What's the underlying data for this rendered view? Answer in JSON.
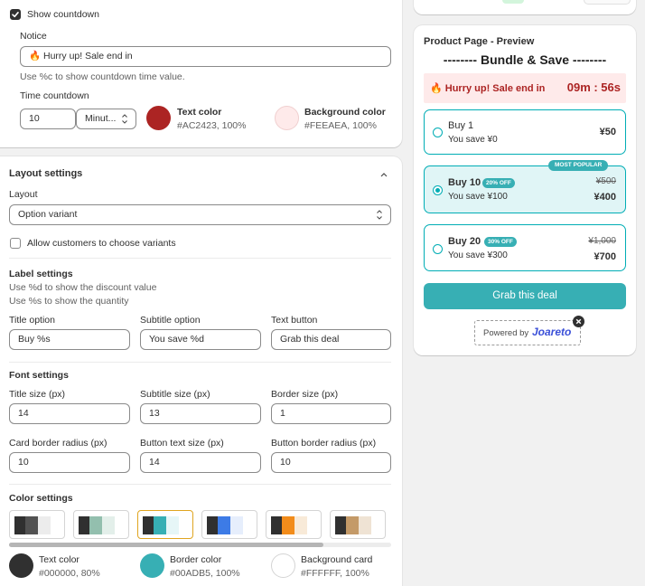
{
  "countdown": {
    "show_label": "Show countdown",
    "notice_label": "Notice",
    "notice_value": "🔥 Hurry up! Sale end in",
    "notice_help": "Use %c to show countdown time value.",
    "time_label": "Time countdown",
    "time_value": "10",
    "time_unit": "Minut...",
    "text_color_label": "Text color",
    "text_color_value": "#AC2423, 100%",
    "bg_color_label": "Background color",
    "bg_color_value": "#FEEAEA, 100%",
    "text_color": "#AC2423",
    "bg_color": "#FEEAEA"
  },
  "layout": {
    "section_title": "Layout settings",
    "layout_label": "Layout",
    "layout_value": "Option variant",
    "allow_label": "Allow customers to choose variants"
  },
  "label_settings": {
    "title": "Label settings",
    "help_1": "Use %d to show the discount value",
    "help_2": "Use %s to show the quantity",
    "title_option_label": "Title option",
    "title_option_value": "Buy %s",
    "subtitle_option_label": "Subtitle option",
    "subtitle_option_value": "You save %d",
    "text_button_label": "Text button",
    "text_button_value": "Grab this deal"
  },
  "font_settings": {
    "title": "Font settings",
    "title_size_label": "Title size (px)",
    "title_size_value": "14",
    "subtitle_size_label": "Subtitle size (px)",
    "subtitle_size_value": "13",
    "border_size_label": "Border size (px)",
    "border_size_value": "1",
    "card_radius_label": "Card border radius (px)",
    "card_radius_value": "10",
    "button_text_size_label": "Button text size (px)",
    "button_text_size_value": "14",
    "button_radius_label": "Button border radius (px)",
    "button_radius_value": "10"
  },
  "color_settings": {
    "title": "Color settings",
    "palettes": [
      [
        "#303030",
        "#525252",
        "#ececec"
      ],
      [
        "#303030",
        "#93bfae",
        "#e3efea"
      ],
      [
        "#303030",
        "#37afb4",
        "#e6f6f7"
      ],
      [
        "#303030",
        "#3d7be6",
        "#e6eefc"
      ],
      [
        "#303030",
        "#f28c1b",
        "#f8ead8"
      ],
      [
        "#303030",
        "#c49a68",
        "#efe3d4"
      ]
    ],
    "text_color_label": "Text color",
    "text_color_value": "#000000, 80%",
    "border_color_label": "Border color",
    "border_color_value": "#00ADB5, 100%",
    "bg_card_label": "Background card",
    "bg_card_value": "#FFFFFF, 100%",
    "text_color": "#303030",
    "border_color": "#37afb4",
    "bg_card_color": "#FFFFFF"
  },
  "preview": {
    "title": "Product Page - Preview",
    "heading": "-------- Bundle & Save --------",
    "countdown_text": "🔥 Hurry up! Sale end in",
    "countdown_time": "09m : 56s",
    "offers": [
      {
        "title": "Buy 1",
        "subtitle": "You save ¥0",
        "price": "¥50",
        "old_price": "",
        "badge": "",
        "top_badge": ""
      },
      {
        "title": "Buy 10",
        "subtitle": "You save ¥100",
        "price": "¥400",
        "old_price": "¥500",
        "badge": "20% OFF",
        "top_badge": "MOST POPULAR"
      },
      {
        "title": "Buy 20",
        "subtitle": "You save ¥300",
        "price": "¥700",
        "old_price": "¥1,000",
        "badge": "30% OFF",
        "top_badge": ""
      }
    ],
    "button_label": "Grab this deal",
    "powered_by": "Powered by",
    "brand": "Joareto",
    "accent": "#37afb4"
  }
}
